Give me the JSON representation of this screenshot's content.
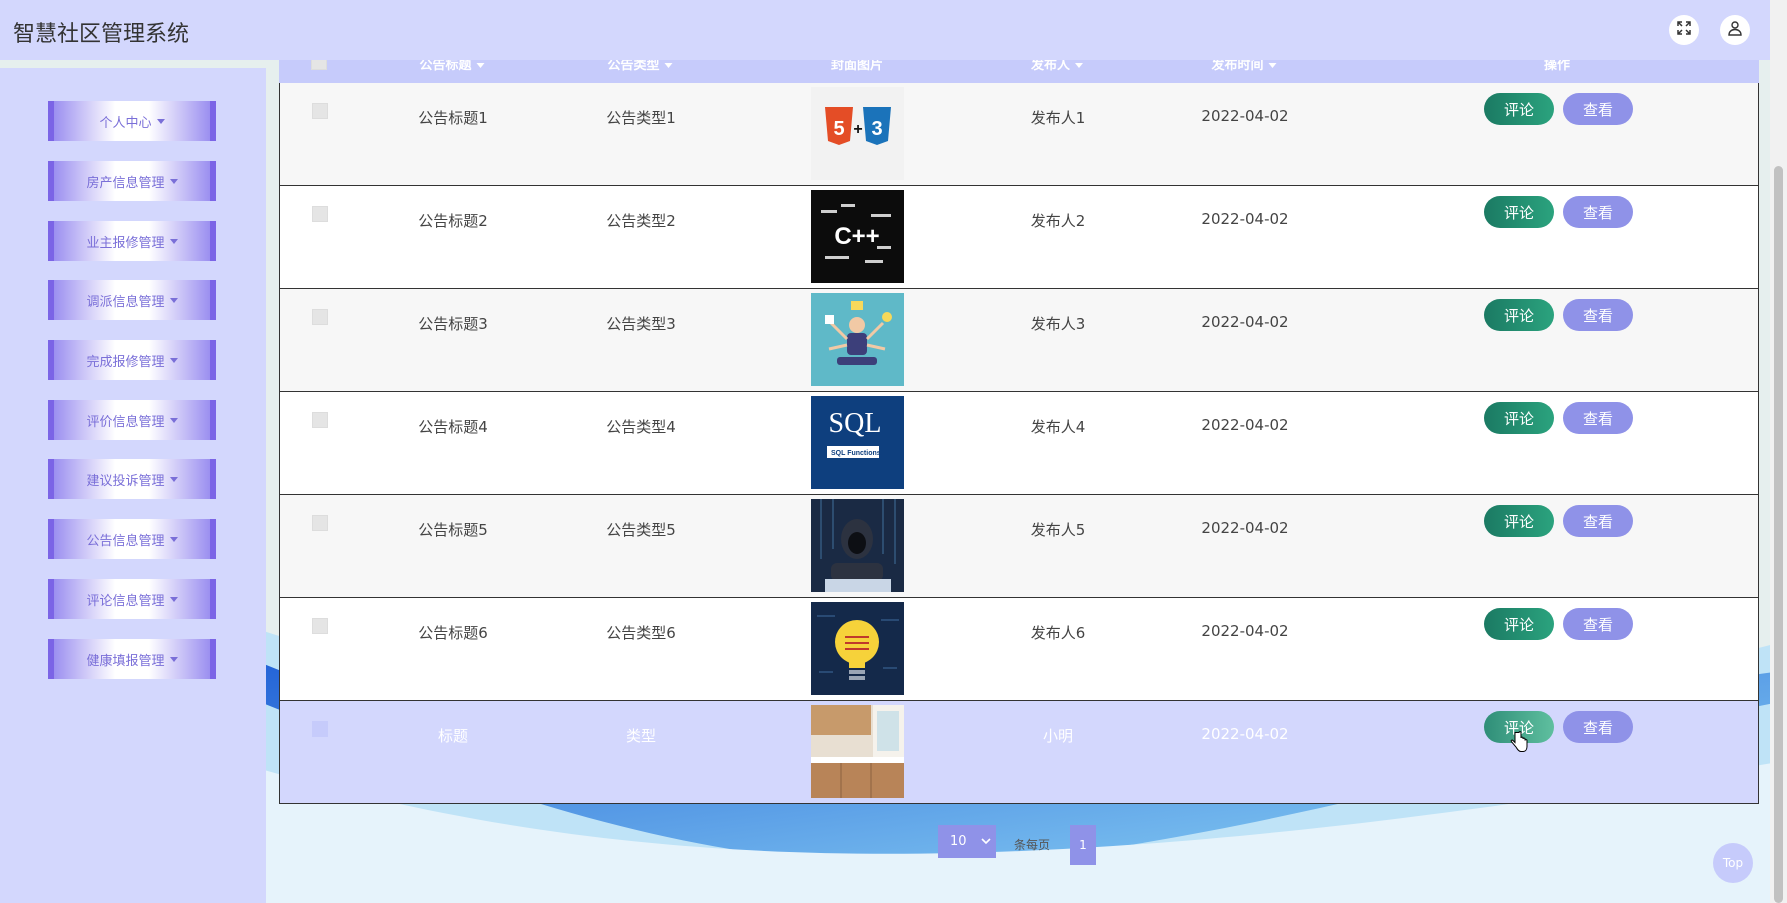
{
  "app": {
    "title": "智慧社区管理系统"
  },
  "header_icons": {
    "fullscreen": "fullscreen-icon",
    "user": "user-icon"
  },
  "sidebar": {
    "items": [
      {
        "label": "个人中心"
      },
      {
        "label": "房产信息管理"
      },
      {
        "label": "业主报修管理"
      },
      {
        "label": "调派信息管理"
      },
      {
        "label": "完成报修管理"
      },
      {
        "label": "评价信息管理"
      },
      {
        "label": "建议投诉管理"
      },
      {
        "label": "公告信息管理"
      },
      {
        "label": "评论信息管理"
      },
      {
        "label": "健康填报管理"
      }
    ]
  },
  "table": {
    "columns": {
      "title": "公告标题",
      "type": "公告类型",
      "cover": "封面图片",
      "publisher": "发布人",
      "date": "发布时间",
      "actions": "操作"
    },
    "comment_label": "评论",
    "view_label": "查看",
    "rows": [
      {
        "title": "公告标题1",
        "type": "公告类型1",
        "cover": "html5-css3",
        "publisher": "发布人1",
        "date": "2022-04-02"
      },
      {
        "title": "公告标题2",
        "type": "公告类型2",
        "cover": "cpp-wordcloud",
        "publisher": "发布人2",
        "date": "2022-04-02"
      },
      {
        "title": "公告标题3",
        "type": "公告类型3",
        "cover": "multitask-person",
        "publisher": "发布人3",
        "date": "2022-04-02"
      },
      {
        "title": "公告标题4",
        "type": "公告类型4",
        "cover": "sql-functions",
        "publisher": "发布人4",
        "date": "2022-04-02"
      },
      {
        "title": "公告标题5",
        "type": "公告类型5",
        "cover": "hacker",
        "publisher": "发布人5",
        "date": "2022-04-02"
      },
      {
        "title": "公告标题6",
        "type": "公告类型6",
        "cover": "lightbulb",
        "publisher": "发布人6",
        "date": "2022-04-02"
      },
      {
        "title": "标题",
        "type": "类型",
        "cover": "kitchen",
        "publisher": "小明",
        "date": "2022-04-02"
      }
    ]
  },
  "thumb_text": {
    "sql_big": "SQL",
    "sql_small": "SQL Functions",
    "cpp": "C++",
    "html5": "5",
    "css3": "3",
    "plus": "+"
  },
  "pagination": {
    "page_size": "10",
    "per_page_label": "条每页",
    "current_page": "1"
  },
  "back_to_top": {
    "label": "Top"
  },
  "colors": {
    "accent": "#8f92e8",
    "header_bg": "#d3d7fd",
    "comment_btn": "#1b7a63",
    "sidebar_frame": "#7b64e6"
  }
}
